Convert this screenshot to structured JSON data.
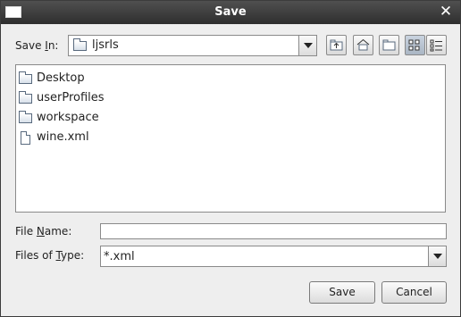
{
  "window": {
    "title": "Save",
    "close_label": "✕"
  },
  "save_in": {
    "label_prefix": "Save ",
    "label_mnemonic": "I",
    "label_suffix": "n:",
    "value": "ljsrls"
  },
  "toolbar": {
    "buttons": [
      {
        "name": "up-one-level",
        "icon": "folder-up-icon"
      },
      {
        "name": "home",
        "icon": "home-icon"
      },
      {
        "name": "new-folder",
        "icon": "new-folder-icon"
      },
      {
        "name": "list-view",
        "icon": "list-view-icon",
        "selected": true
      },
      {
        "name": "details-view",
        "icon": "details-view-icon",
        "selected": false
      }
    ]
  },
  "files": [
    {
      "name": "Desktop",
      "type": "folder"
    },
    {
      "name": "userProfiles",
      "type": "folder"
    },
    {
      "name": "workspace",
      "type": "folder"
    },
    {
      "name": "wine.xml",
      "type": "file"
    }
  ],
  "file_name": {
    "label_prefix": "File ",
    "label_mnemonic": "N",
    "label_suffix": "ame:",
    "value": ""
  },
  "file_type": {
    "label_prefix": "Files of ",
    "label_mnemonic": "T",
    "label_suffix": "ype:",
    "value": "*.xml"
  },
  "actions": {
    "save_label": "Save",
    "cancel_label": "Cancel"
  }
}
